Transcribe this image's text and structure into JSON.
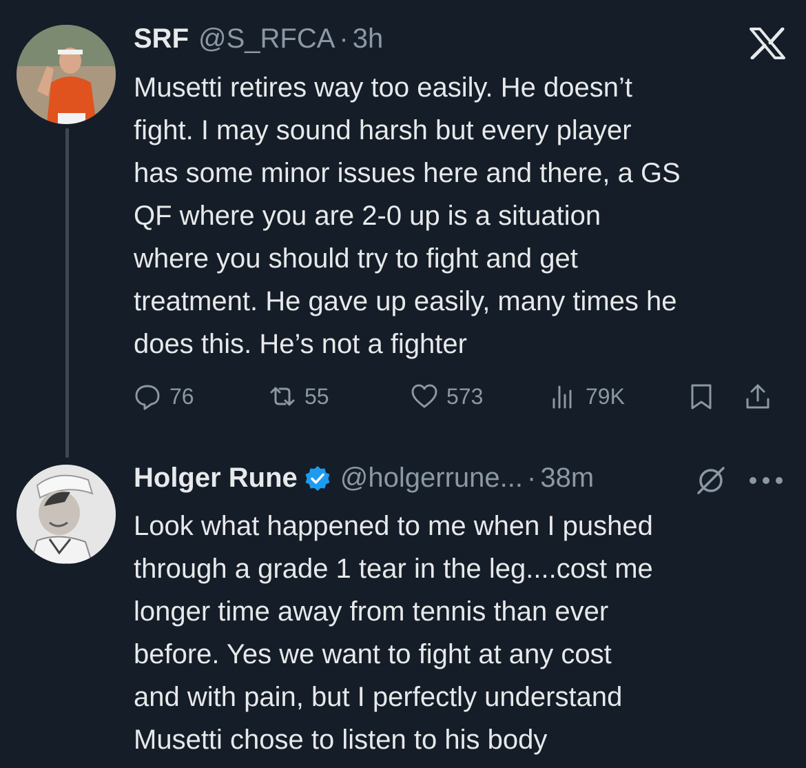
{
  "brand": {
    "logo": "x-logo",
    "icon_color": "#e7e9ea"
  },
  "colors": {
    "background": "#151d28",
    "text": "#e7e9ea",
    "muted": "#8b98a5",
    "verified": "#1d9bf0"
  },
  "original_post": {
    "avatar_icon": "avatar",
    "name": "SRF",
    "handle": "@S_RFCA",
    "separator": "·",
    "time": "3h",
    "text_lines": [
      "Musetti retires way too easily. He doesn’t",
      "fight. I may sound harsh but every player",
      "has some minor issues here and there, a GS",
      "QF where you are 2-0 up is a situation",
      "where you should try to fight and get",
      "treatment. He gave up easily, many times he",
      "does this. He’s not a fighter"
    ],
    "actions": {
      "replies": {
        "icon": "reply-icon",
        "count": "76"
      },
      "reposts": {
        "icon": "repost-icon",
        "count": "55"
      },
      "likes": {
        "icon": "heart-icon",
        "count": "573"
      },
      "views": {
        "icon": "views-icon",
        "count": "79K"
      },
      "bookmark": {
        "icon": "bookmark-icon"
      },
      "share": {
        "icon": "share-icon"
      }
    }
  },
  "reply_post": {
    "avatar_icon": "avatar",
    "name": "Holger Rune",
    "verified_icon": "verified-badge-icon",
    "handle": "@holgerrune...",
    "separator": "·",
    "time": "38m",
    "extra_icons": [
      "grok-icon",
      "more-icon"
    ],
    "text_lines": [
      "Look what happened to me when I pushed",
      "through a grade 1 tear in the leg....cost me",
      "longer time away from tennis than ever",
      "before. Yes we want to fight at any cost",
      "and with pain, but I perfectly understand",
      "Musetti chose to listen to his body"
    ]
  }
}
